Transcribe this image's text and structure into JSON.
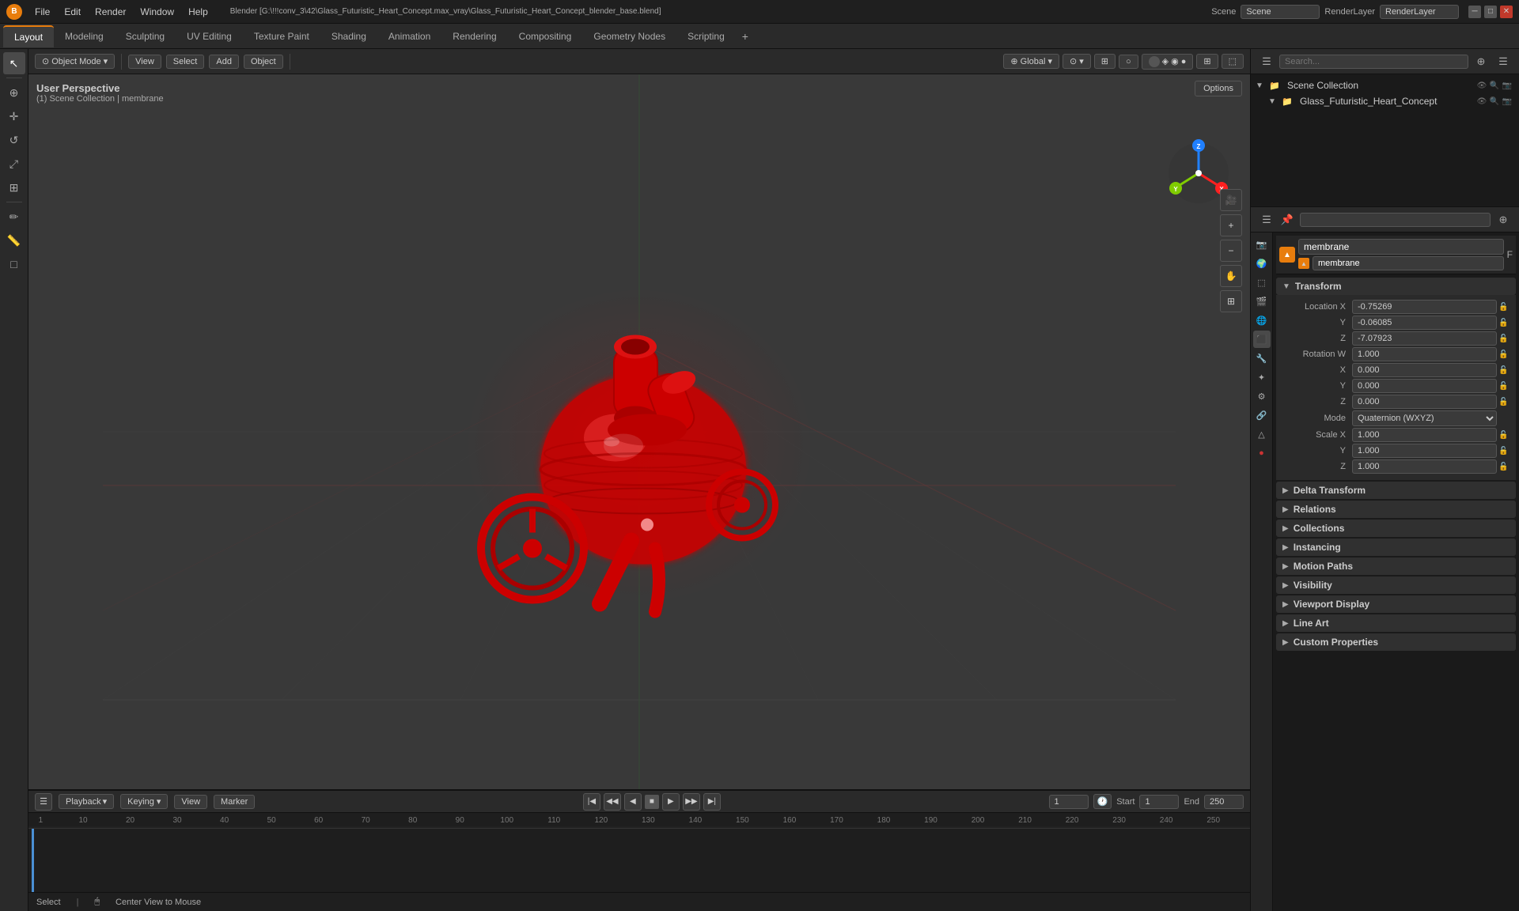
{
  "titlebar": {
    "title": "Blender [G:\\!!!conv_3\\42\\Glass_Futuristic_Heart_Concept.max_vray\\Glass_Futuristic_Heart_Concept_blender_base.blend]",
    "menu": [
      "File",
      "Edit",
      "Render",
      "Window",
      "Help"
    ],
    "window_controls": [
      "_",
      "☐",
      "✕"
    ],
    "scene_label": "Scene",
    "render_layer_label": "RenderLayer"
  },
  "workspace_tabs": {
    "tabs": [
      "Layout",
      "Modeling",
      "Sculpting",
      "UV Editing",
      "Texture Paint",
      "Shading",
      "Animation",
      "Rendering",
      "Compositing",
      "Geometry Nodes",
      "Scripting",
      "+"
    ],
    "active": "Layout"
  },
  "viewport": {
    "mode": "Object Mode",
    "view": "Global",
    "info_line": "User Perspective",
    "collection_info": "(1) Scene Collection | membrane",
    "options_label": "Options"
  },
  "viewport_header": {
    "mode_btn": "Object Mode",
    "view_btn": "View",
    "select_btn": "Select",
    "add_btn": "Add",
    "object_btn": "Object",
    "global_label": "Global",
    "icons": [
      "⊕",
      "⊙",
      "◈",
      "◉",
      "□",
      "⋯"
    ]
  },
  "gizmo": {
    "x_label": "X",
    "y_label": "Y",
    "z_label": "Z",
    "x_color": "#ff2020",
    "y_color": "#80cc00",
    "z_color": "#2080ff"
  },
  "outliner": {
    "header_icons": [
      "≡",
      "☰",
      "⊕"
    ],
    "search_placeholder": "",
    "items": [
      {
        "label": "Scene Collection",
        "icon": "📁",
        "expanded": true,
        "level": 0,
        "special": "scene-collection"
      },
      {
        "label": "Glass_Futuristic_Heart_Concept",
        "icon": "▼",
        "expanded": true,
        "level": 1
      }
    ]
  },
  "properties": {
    "object_name": "membrane",
    "inner_name": "membrane",
    "sections": {
      "transform": {
        "label": "Transform",
        "expanded": true,
        "location": {
          "x": "-0.75269",
          "y": "-0.06085",
          "z": "-7.07923"
        },
        "rotation_w": "1.000",
        "rotation": {
          "x": "0.000",
          "y": "0.000",
          "z": "0.000"
        },
        "mode": "Quaternion (WXYZ)",
        "scale": {
          "x": "1.000",
          "y": "1.000",
          "z": "1.000"
        }
      },
      "delta_transform": {
        "label": "Delta Transform",
        "expanded": false
      },
      "relations": {
        "label": "Relations",
        "expanded": false
      },
      "collections": {
        "label": "Collections",
        "expanded": false
      },
      "instancing": {
        "label": "Instancing",
        "expanded": false
      },
      "motion_paths": {
        "label": "Motion Paths",
        "expanded": false
      },
      "visibility": {
        "label": "Visibility",
        "expanded": false
      },
      "viewport_display": {
        "label": "Viewport Display",
        "expanded": false
      },
      "line_art": {
        "label": "Line Art",
        "expanded": false
      },
      "custom_properties": {
        "label": "Custom Properties",
        "expanded": false
      }
    },
    "sidebar_icons": [
      "📷",
      "🌍",
      "💡",
      "🎨",
      "🔧",
      "📐",
      "🔗",
      "🖥",
      "⬛"
    ],
    "labels": {
      "location_x": "X",
      "location_y": "Y",
      "location_z": "Z",
      "rotation_w": "Rotation W",
      "rotation_x": "X",
      "rotation_y": "Y",
      "rotation_z": "Z",
      "mode_label": "Mode",
      "scale_x": "Scale X",
      "scale_y": "Y",
      "scale_z": "Z"
    }
  },
  "timeline": {
    "header_buttons": [
      "Playback",
      "Keying",
      "View",
      "Marker"
    ],
    "playback_label": "Playback",
    "frame_current": "1",
    "frame_start_label": "Start",
    "frame_start": "1",
    "frame_end_label": "End",
    "frame_end": "250",
    "ruler_ticks": [
      "1",
      "10",
      "20",
      "30",
      "40",
      "50",
      "60",
      "70",
      "80",
      "90",
      "100",
      "110",
      "120",
      "130",
      "140",
      "150",
      "160",
      "170",
      "180",
      "190",
      "200",
      "210",
      "220",
      "230",
      "240",
      "250"
    ]
  },
  "status_bar": {
    "left": "Select",
    "center": "Center View to Mouse",
    "icon_hint": "🖱"
  },
  "colors": {
    "accent": "#e87d0d",
    "background_dark": "#1a1a1a",
    "background_panel": "#2a2a2a",
    "background_input": "#3a3a3a",
    "active_blue": "#1d4170",
    "border": "#555555",
    "text_primary": "#cccccc",
    "text_dim": "#aaaaaa",
    "heart_red": "#cc1111",
    "grid_line": "#444444"
  }
}
